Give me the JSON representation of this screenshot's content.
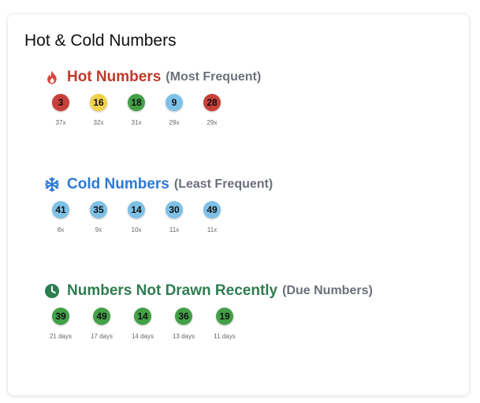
{
  "card": {
    "title": "Hot & Cold Numbers"
  },
  "colors": {
    "hot": "#c0392b",
    "cold": "#2d7ad6",
    "due": "#2e7d4f",
    "ball_red": "#c9403a",
    "ball_yellow": "#f0d24a",
    "ball_green": "#43a047",
    "ball_blue": "#7ec1e6",
    "muted": "#6b7079"
  },
  "hot": {
    "icon": "fire-icon",
    "title": "Hot Numbers",
    "subtitle": "(Most Frequent)",
    "numbers": [
      {
        "value": "3",
        "label": "37x",
        "color": "#c9403a"
      },
      {
        "value": "16",
        "label": "32x",
        "color": "#f0d24a"
      },
      {
        "value": "18",
        "label": "31x",
        "color": "#43a047"
      },
      {
        "value": "9",
        "label": "29x",
        "color": "#7ec1e6"
      },
      {
        "value": "28",
        "label": "29x",
        "color": "#c9403a"
      }
    ]
  },
  "cold": {
    "icon": "snowflake-icon",
    "title": "Cold Numbers",
    "subtitle": "(Least Frequent)",
    "numbers": [
      {
        "value": "41",
        "label": "8x",
        "color": "#7ec1e6"
      },
      {
        "value": "35",
        "label": "9x",
        "color": "#7ec1e6"
      },
      {
        "value": "14",
        "label": "10x",
        "color": "#7ec1e6"
      },
      {
        "value": "30",
        "label": "11x",
        "color": "#7ec1e6"
      },
      {
        "value": "49",
        "label": "11x",
        "color": "#7ec1e6"
      }
    ]
  },
  "due": {
    "icon": "clock-icon",
    "title": "Numbers Not Drawn Recently",
    "subtitle": "(Due Numbers)",
    "numbers": [
      {
        "value": "39",
        "label": "21 days",
        "color": "#43a047"
      },
      {
        "value": "49",
        "label": "17 days",
        "color": "#43a047"
      },
      {
        "value": "14",
        "label": "14 days",
        "color": "#43a047"
      },
      {
        "value": "36",
        "label": "13 days",
        "color": "#43a047"
      },
      {
        "value": "19",
        "label": "11 days",
        "color": "#43a047"
      }
    ]
  }
}
